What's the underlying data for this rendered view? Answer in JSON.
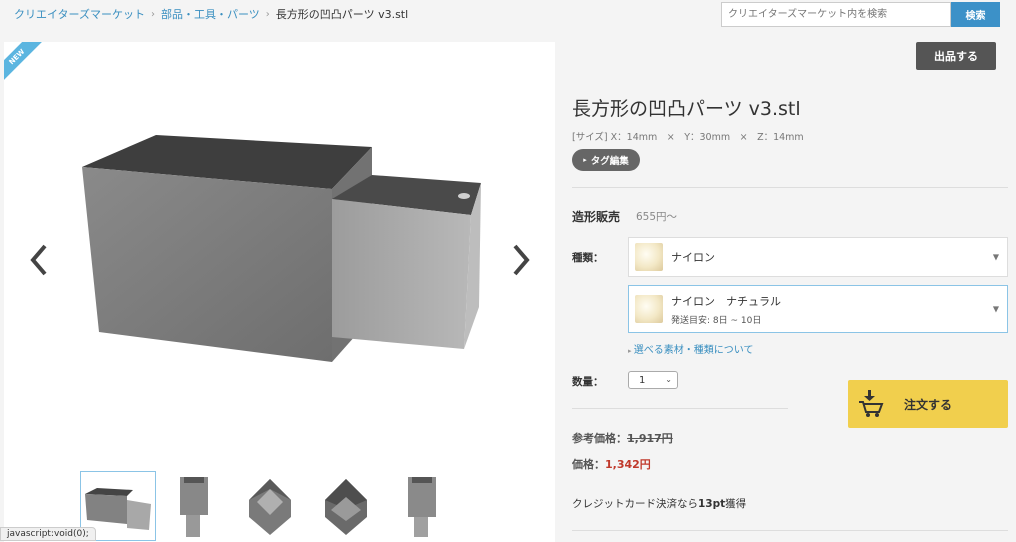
{
  "breadcrumb": {
    "items": [
      "クリエイターズマーケット",
      "部品・工具・パーツ"
    ],
    "current": "長方形の凹凸パーツ v3.stl"
  },
  "search": {
    "placeholder": "クリエイターズマーケット内を検索",
    "button": "検索"
  },
  "viewer": {
    "badge": "NEW",
    "prev_icon": "chevron-left-icon",
    "next_icon": "chevron-right-icon",
    "thumbnail_count": 5
  },
  "sell_button": "出品する",
  "product": {
    "title": "長方形の凹凸パーツ v3.stl",
    "size": "[サイズ] X：14mm　×　Y：30mm　×　Z：14mm",
    "tag_button": "タグ編集"
  },
  "sale": {
    "label": "造形販売",
    "price": "655円～"
  },
  "kind": {
    "label": "種類：",
    "material": "ナイロン",
    "variant": "ナイロン　ナチュラル",
    "shipping": "発送目安: 8日 ~ 10日",
    "link": "選べる素材・種類について"
  },
  "quantity": {
    "label": "数量：",
    "value": "1"
  },
  "order_button": "注文する",
  "pricing": {
    "ref_label": "参考価格：",
    "ref_value": "1,917円",
    "price_label": "価格：",
    "price_value": "1,342円",
    "points_prefix": "クレジットカード決済なら",
    "points_value": "13pt",
    "points_suffix": "獲得"
  },
  "status_bar": "javascript:void(0);",
  "colors": {
    "accent": "#3c91c8",
    "order": "#f1cf4d",
    "price": "#c0392b"
  }
}
